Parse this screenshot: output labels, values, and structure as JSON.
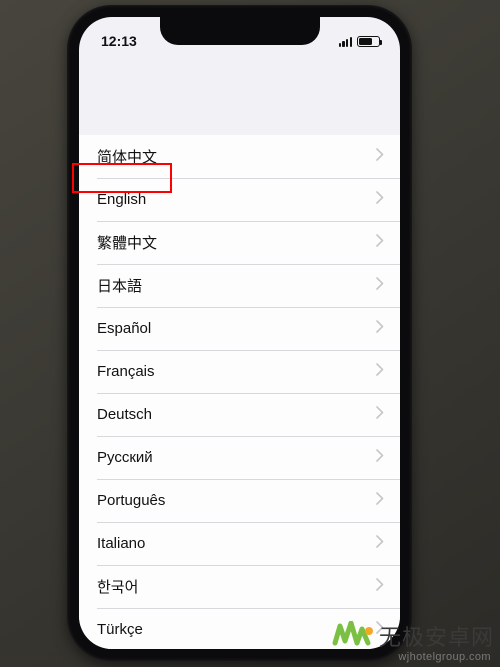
{
  "status_bar": {
    "time": "12:13"
  },
  "languages": {
    "items": [
      {
        "label": "简体中文"
      },
      {
        "label": "English"
      },
      {
        "label": "繁體中文"
      },
      {
        "label": "日本語"
      },
      {
        "label": "Español"
      },
      {
        "label": "Français"
      },
      {
        "label": "Deutsch"
      },
      {
        "label": "Русский"
      },
      {
        "label": "Português"
      },
      {
        "label": "Italiano"
      },
      {
        "label": "한국어"
      },
      {
        "label": "Türkçe"
      }
    ]
  },
  "highlight_index": 0,
  "watermark": {
    "brand": "无极安卓网",
    "url": "wjhotelgroup.com"
  },
  "colors": {
    "highlight": "#ff0000",
    "brand_green": "#7bc043",
    "brand_orange": "#f5a623"
  }
}
